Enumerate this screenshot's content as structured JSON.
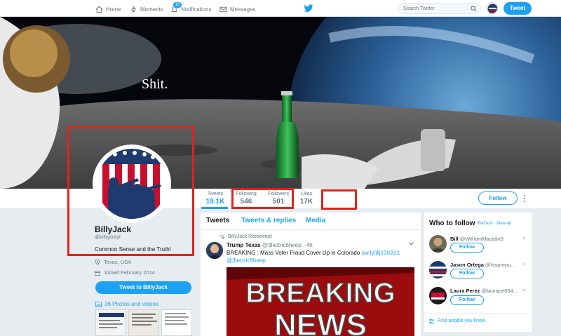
{
  "nav": {
    "home": "Home",
    "moments": "Moments",
    "notifications": "Notifications",
    "notification_count": "16",
    "messages": "Messages",
    "search_placeholder": "Search Twitter",
    "tweet_button": "Tweet"
  },
  "banner": {
    "caption": "Shit."
  },
  "stats": [
    {
      "label": "Tweets",
      "value": "19.1K"
    },
    {
      "label": "Following",
      "value": "546"
    },
    {
      "label": "Followers",
      "value": "501"
    },
    {
      "label": "Likes",
      "value": "17K"
    }
  ],
  "follow_button": "Follow",
  "profile": {
    "name": "BillyJack",
    "handle": "@billyjackyl",
    "bio": "Common Sense and the Truth!",
    "location": "Texas, USA",
    "joined": "Joined February 2014",
    "tweet_to": "Tweet to BillyJack",
    "photos": "36 Photos and videos"
  },
  "timeline": {
    "tabs": [
      "Tweets",
      "Tweets & replies",
      "Media"
    ],
    "retweet_note": "BillyJack Retweeted",
    "tweet": {
      "author": "Trump Texas",
      "author_handle": "@3lectric5heep",
      "time": "· 4h",
      "text": "BREAKING : Mass Voter Fraud Cover Up in Colorado",
      "link": "ow.ly/jllj100Jiz1",
      "mention": "@3lectric5heep",
      "image_text_1": "BREAKING",
      "image_text_2": "NEWS"
    }
  },
  "who_to_follow": {
    "title": "Who to follow",
    "refresh": "· Refresh",
    "view_all": "· View all",
    "suggestions": [
      {
        "name": "Bill",
        "handle": "@WilliamMauldin9",
        "button": "Follow"
      },
      {
        "name": "Jason Ortega",
        "handle": "@hisprepu…",
        "button": "Follow"
      },
      {
        "name": "Laura Perez",
        "handle": "@laurape004…",
        "button": "Follow"
      }
    ],
    "find_people": "Find people you know"
  },
  "colors": {
    "accent": "#1da1f2",
    "highlight_box": "#e0241a"
  },
  "icons": [
    "home-icon",
    "moments-icon",
    "notifications-icon",
    "messages-icon",
    "twitter-bird-icon",
    "search-icon",
    "location-icon",
    "calendar-icon",
    "photo-icon",
    "retweet-icon",
    "caret-down-icon",
    "people-icon",
    "more-icon"
  ]
}
